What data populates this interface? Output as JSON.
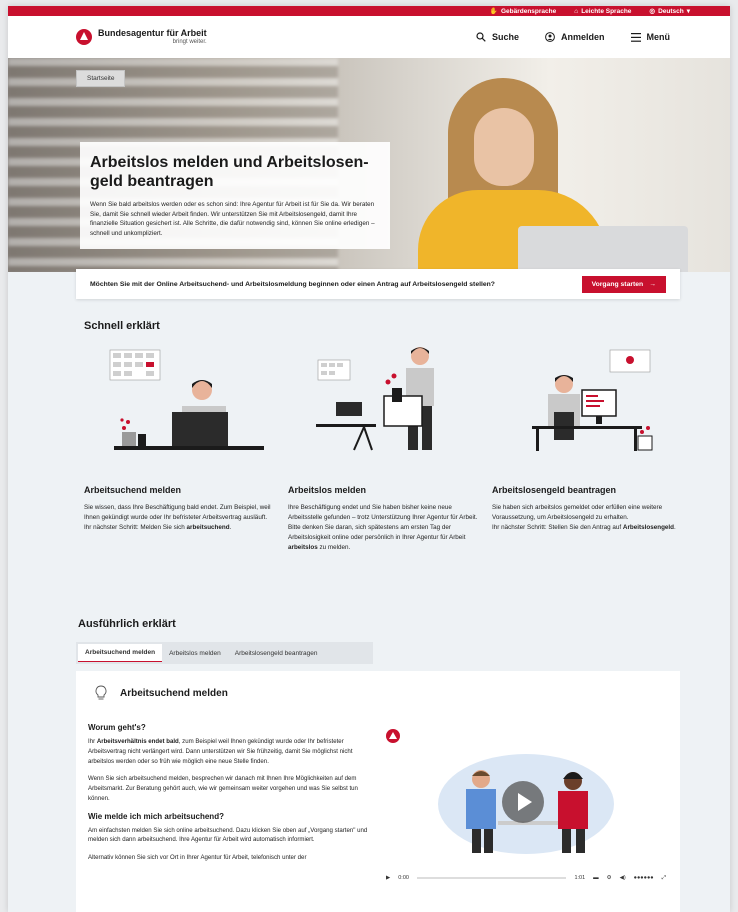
{
  "topbar": {
    "sign_language": "Gebärdensprache",
    "easy_language": "Leichte Sprache",
    "language": "Deutsch"
  },
  "header": {
    "logo_name": "Bundesagentur für Arbeit",
    "logo_tagline": "bringt weiter.",
    "search": "Suche",
    "login": "Anmelden",
    "menu": "Menü"
  },
  "hero": {
    "breadcrumb": "Startseite",
    "title": "Arbeitslos melden und Arbeitslosen-geld beantragen",
    "text": "Wenn Sie bald arbeitslos werden oder es schon sind: Ihre Agentur für Arbeit ist für Sie da. Wir beraten Sie, damit Sie schnell wieder Arbeit finden. Wir unterstützen Sie mit Arbeitslosengeld, damit Ihre finanzielle Situation gesichert ist. Alle Schritte, die dafür notwendig sind, können Sie online erledigen – schnell und unkompliziert."
  },
  "cta": {
    "question": "Möchten Sie mit der Online Arbeitsuchend- und Arbeitslosmeldung beginnen oder einen Antrag auf Arbeitslosengeld stellen?",
    "button": "Vorgang starten",
    "button_arrow": "→"
  },
  "quick": {
    "title": "Schnell erklärt",
    "items": [
      {
        "title": "Arbeitsuchend melden",
        "text1": "Sie wissen, dass Ihre Beschäftigung bald endet. Zum Beispiel, weil Ihnen gekündigt wurde oder Ihr befristeter Arbeitsvertrag ausläuft.",
        "text2": "Ihr nächster Schritt: Melden Sie sich ",
        "bold": "arbeitsuchend",
        "end": "."
      },
      {
        "title": "Arbeitslos melden",
        "text1": "Ihre Beschäftigung endet und Sie haben bisher keine neue Arbeitsstelle gefunden – trotz Unterstützung Ihrer Agentur für Arbeit.",
        "text2": "Bitte denken Sie daran, sich spätestens am ersten Tag der Arbeitslosigkeit online oder persönlich in Ihrer Agentur für Arbeit ",
        "bold": "arbeitslos",
        "end": " zu melden."
      },
      {
        "title": "Arbeitslosengeld beantragen",
        "text1": "Sie haben sich arbeitslos gemeldet oder erfüllen eine weitere Voraussetzung, um Arbeitslosengeld zu erhalten.",
        "text2": "Ihr nächster Schritt: Stellen Sie den Antrag auf ",
        "bold": "Arbeitslosengeld",
        "end": "."
      }
    ]
  },
  "detail": {
    "title": "Ausführlich erklärt",
    "tabs": [
      "Arbeitsuchend melden",
      "Arbeitslos melden",
      "Arbeitslosengeld beantragen"
    ],
    "card_title": "Arbeitsuchend melden",
    "q1": "Worum geht's?",
    "p1_bold": "Arbeitsverhältnis endet bald",
    "p1_pre": "Ihr ",
    "p1_post": ", zum Beispiel weil Ihnen gekündigt wurde oder Ihr befristeter Arbeitsvertrag nicht verlängert wird. Dann unterstützen wir Sie frühzeitig, damit Sie möglichst nicht arbeitslos werden oder so früh wie möglich eine neue Stelle finden.",
    "p2": "Wenn Sie sich arbeitsuchend melden, besprechen wir danach mit Ihnen Ihre Möglichkeiten auf dem Arbeitsmarkt. Zur Beratung gehört auch, wie wir gemeinsam weiter vorgehen und was Sie selbst tun können.",
    "q2": "Wie melde ich mich arbeitsuchend?",
    "p3": "Am einfachsten melden Sie sich online arbeitsuchend. Dazu klicken Sie oben auf „Vorgang starten\" und melden sich dann arbeitsuchend. Ihre Agentur für Arbeit wird automatisch informiert.",
    "p4": "Alternativ können Sie sich vor Ort in Ihrer Agentur für Arbeit, telefonisch unter der",
    "video": {
      "time_current": "0:00",
      "time_total": "1:01",
      "progress": 0
    }
  }
}
